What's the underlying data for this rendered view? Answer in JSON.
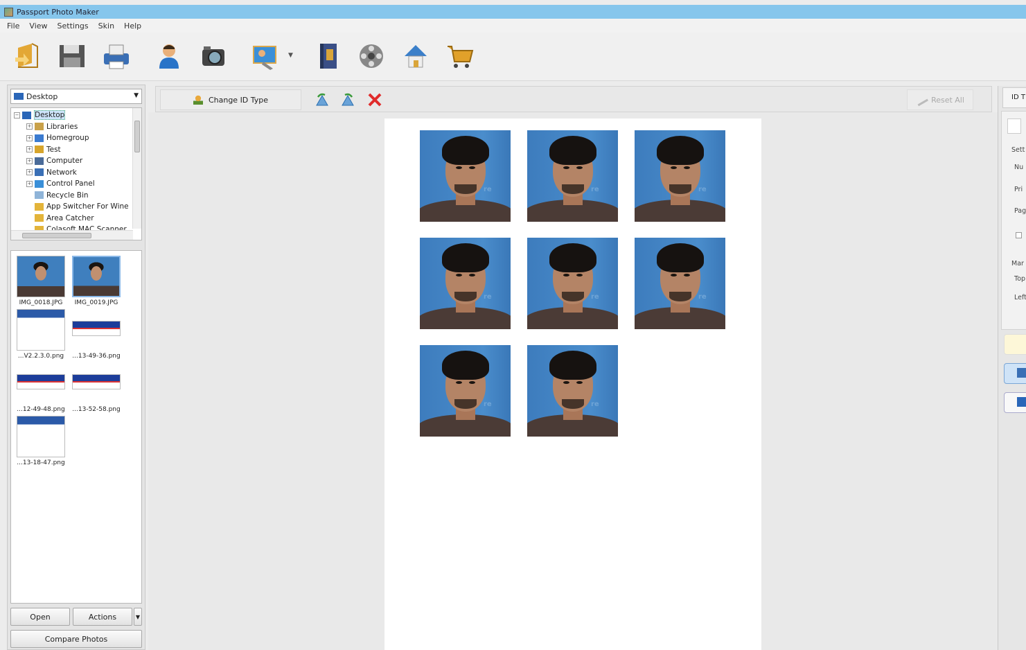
{
  "window": {
    "title": "Passport Photo Maker"
  },
  "menu": [
    "File",
    "View",
    "Settings",
    "Skin",
    "Help"
  ],
  "toolbar": {
    "buttons": [
      {
        "name": "open-icon",
        "color": "#e3a735"
      },
      {
        "name": "save-icon",
        "color": "#555555"
      },
      {
        "name": "print-icon",
        "color": "#3a6fb5"
      },
      {
        "name": "person-icon",
        "color": "#2a74c8"
      },
      {
        "name": "camera-icon",
        "color": "#444444"
      },
      {
        "name": "photo-edit-icon",
        "color": "#3a8fd8"
      },
      {
        "name": "help-book-icon",
        "color": "#3a4f86"
      },
      {
        "name": "video-reel-icon",
        "color": "#666666"
      },
      {
        "name": "home-icon",
        "color": "#3b7fc9"
      },
      {
        "name": "cart-icon",
        "color": "#e1a12a"
      }
    ]
  },
  "left": {
    "folder_select": "Desktop",
    "tree": [
      {
        "label": "Desktop",
        "level": 0,
        "expander": "−",
        "selected": true,
        "color": "#2a66b8"
      },
      {
        "label": "Libraries",
        "level": 1,
        "expander": "+",
        "color": "#c9a14a"
      },
      {
        "label": "Homegroup",
        "level": 1,
        "expander": "+",
        "color": "#3b7bd0"
      },
      {
        "label": "Test",
        "level": 1,
        "expander": "+",
        "color": "#d7a52c"
      },
      {
        "label": "Computer",
        "level": 1,
        "expander": "+",
        "color": "#4a6b99"
      },
      {
        "label": "Network",
        "level": 1,
        "expander": "+",
        "color": "#3a6fb5"
      },
      {
        "label": "Control Panel",
        "level": 1,
        "expander": "+",
        "color": "#3a8fd8"
      },
      {
        "label": "Recycle Bin",
        "level": 1,
        "expander": "",
        "color": "#8fb4d8"
      },
      {
        "label": "App Switcher For Wine",
        "level": 1,
        "expander": "",
        "color": "#e3b43a"
      },
      {
        "label": "Area Catcher",
        "level": 1,
        "expander": "",
        "color": "#e3b43a"
      },
      {
        "label": "Colasoft MAC Scanner",
        "level": 1,
        "expander": "",
        "color": "#e3b43a"
      }
    ],
    "thumbnails": [
      {
        "caption": "IMG_0018.JPG",
        "kind": "face",
        "selected": false
      },
      {
        "caption": "IMG_0019.JPG",
        "kind": "face",
        "selected": true
      },
      {
        "caption": "...V2.2.3.0.png",
        "kind": "shot1",
        "selected": false
      },
      {
        "caption": "...13-49-36.png",
        "kind": "shot2",
        "selected": false
      },
      {
        "caption": "...12-49-48.png",
        "kind": "shot2",
        "selected": false
      },
      {
        "caption": "...13-52-58.png",
        "kind": "shot2",
        "selected": false
      },
      {
        "caption": "...13-18-47.png",
        "kind": "shot1",
        "selected": false
      }
    ],
    "open_label": "Open",
    "actions_label": "Actions",
    "compare_label": "Compare Photos"
  },
  "center": {
    "change_id_label": "Change ID Type",
    "reset_label": "Reset All",
    "photo_count": 8,
    "watermark": "re"
  },
  "right": {
    "tab_label": "ID T",
    "labels": [
      "Sett",
      "Nu",
      "Pri",
      "Pag",
      "Mar",
      "Top",
      "Left"
    ]
  }
}
